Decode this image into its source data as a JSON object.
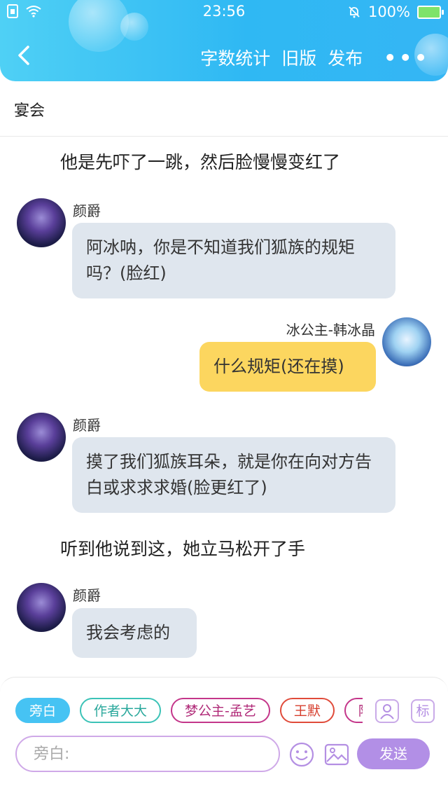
{
  "status_bar": {
    "time": "23:56",
    "battery": "100%"
  },
  "nav": {
    "word_count": "字数统计",
    "old_version": "旧版",
    "publish": "发布",
    "more": "•••"
  },
  "chapter_title": "宴会",
  "chat": {
    "narration_1": "他是先吓了一跳，然后脸慢慢变红了",
    "msg_1": {
      "name": "颜爵",
      "text": "阿冰呐，你是不知道我们狐族的规矩吗？(脸红)"
    },
    "msg_2": {
      "name": "冰公主-韩冰晶",
      "text": "什么规矩(还在摸)"
    },
    "msg_3": {
      "name": "颜爵",
      "text": "摸了我们狐族耳朵，就是你在向对方告白或求求求婚(脸更红了)"
    },
    "narration_2": "听到他说到这，她立马松开了手",
    "msg_4": {
      "name": "颜爵",
      "text": "我会考虑的"
    }
  },
  "characters": [
    {
      "label": "旁白",
      "color": "#46c3f3"
    },
    {
      "label": "作者大大",
      "color": "#3cc3b7"
    },
    {
      "label": "梦公主-孟艺",
      "color": "#c4368a"
    },
    {
      "label": "王默",
      "color": "#e04b3a"
    },
    {
      "label": "陌",
      "color": "#c4368a"
    }
  ],
  "tools": {
    "tag_label": "标"
  },
  "composer": {
    "placeholder": "旁白:",
    "send_label": "发送"
  },
  "colors": {
    "header": "#35b6f4",
    "bubble_other": "#dfe6ee",
    "bubble_mine": "#fcd65f",
    "accent": "#b28fe6"
  }
}
